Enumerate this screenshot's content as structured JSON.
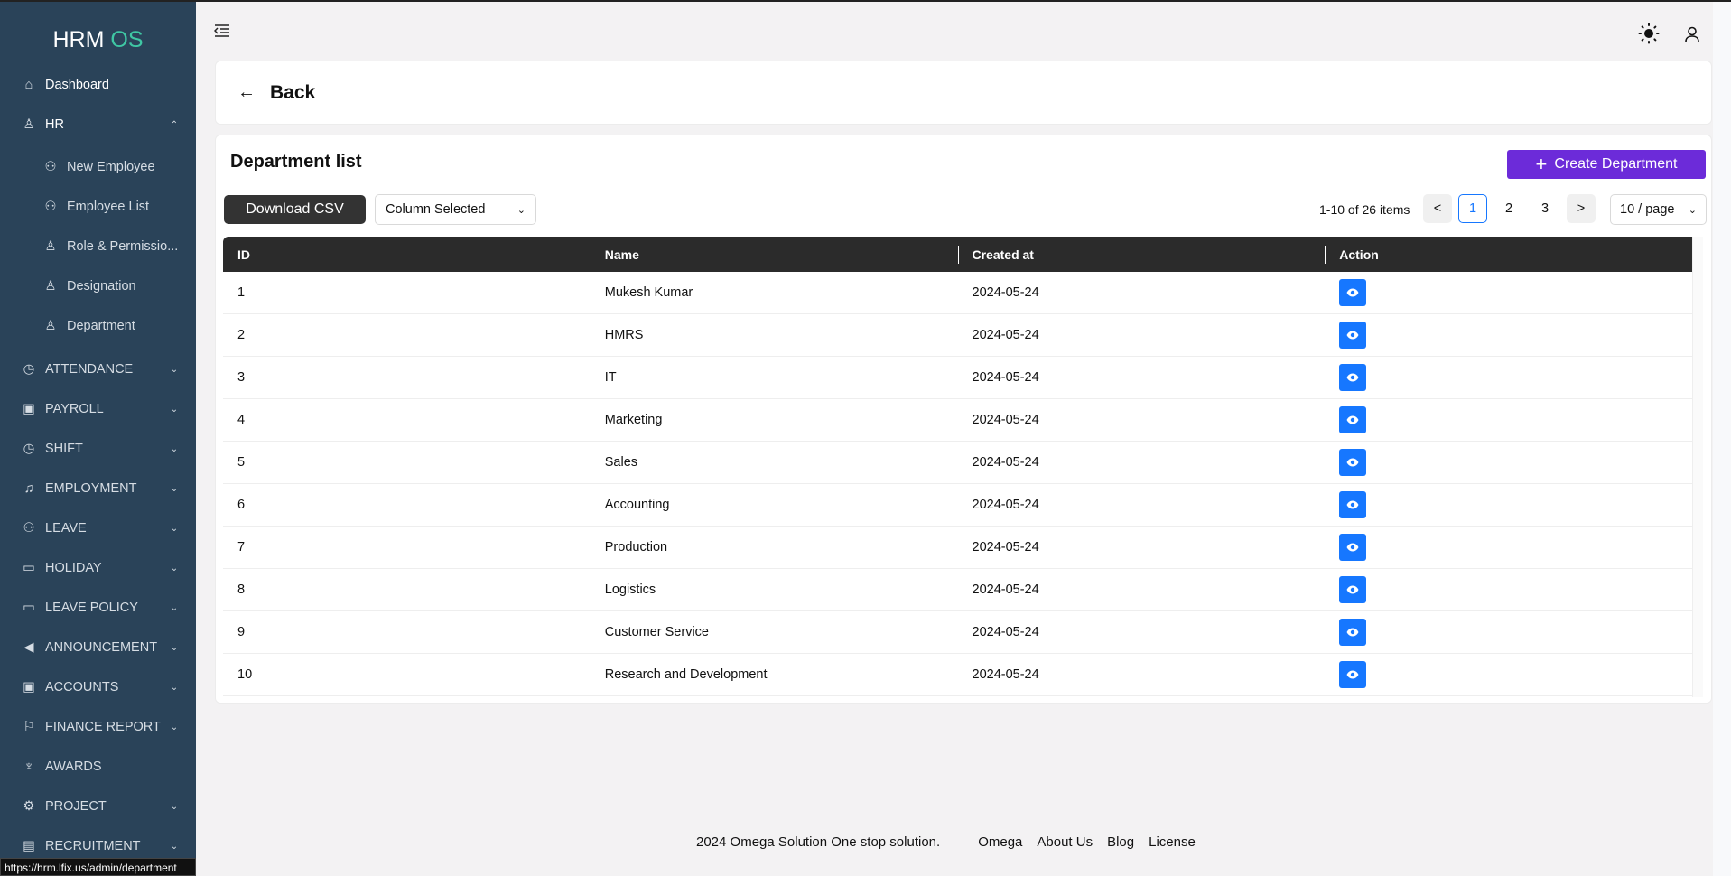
{
  "app": {
    "logo_main": "HRM",
    "logo_accent": "OS"
  },
  "sidebar": {
    "items": [
      {
        "label": "Dashboard",
        "icon": "home-icon"
      },
      {
        "label": "HR",
        "icon": "user-icon",
        "expanded": true
      },
      {
        "label": "New Employee",
        "icon": "users-icon"
      },
      {
        "label": "Employee List",
        "icon": "users-icon"
      },
      {
        "label": "Role & Permissio...",
        "icon": "user-gear-icon"
      },
      {
        "label": "Designation",
        "icon": "user-gear-icon"
      },
      {
        "label": "Department",
        "icon": "user-gear-icon"
      },
      {
        "label": "ATTENDANCE",
        "icon": "clock-icon"
      },
      {
        "label": "PAYROLL",
        "icon": "wallet-icon"
      },
      {
        "label": "SHIFT",
        "icon": "clock-icon"
      },
      {
        "label": "EMPLOYMENT",
        "icon": "bell-icon"
      },
      {
        "label": "LEAVE",
        "icon": "users-icon"
      },
      {
        "label": "HOLIDAY",
        "icon": "calendar-icon"
      },
      {
        "label": "LEAVE POLICY",
        "icon": "calendar-icon"
      },
      {
        "label": "ANNOUNCEMENT",
        "icon": "megaphone-icon"
      },
      {
        "label": "ACCOUNTS",
        "icon": "wallet-icon"
      },
      {
        "label": "FINANCE REPORT",
        "icon": "flag-icon"
      },
      {
        "label": "AWARDS",
        "icon": "trophy-icon"
      },
      {
        "label": "PROJECT",
        "icon": "gear-icon"
      },
      {
        "label": "RECRUITMENT",
        "icon": "document-search-icon"
      }
    ]
  },
  "status_url": "https://hrm.lfix.us/admin/department",
  "back": {
    "label": "Back"
  },
  "main": {
    "title": "Department list",
    "create_label": "Create Department",
    "download_label": "Download CSV",
    "column_select": "Column Selected",
    "pagination": {
      "info": "1-10 of 26 items",
      "pages": [
        "1",
        "2",
        "3"
      ],
      "current": "1",
      "page_size": "10 / page",
      "prev": "<",
      "next": ">"
    },
    "columns": [
      "ID",
      "Name",
      "Created at",
      "Action"
    ],
    "rows": [
      {
        "id": "1",
        "name": "Mukesh Kumar",
        "created": "2024-05-24"
      },
      {
        "id": "2",
        "name": "HMRS",
        "created": "2024-05-24"
      },
      {
        "id": "3",
        "name": "IT",
        "created": "2024-05-24"
      },
      {
        "id": "4",
        "name": "Marketing",
        "created": "2024-05-24"
      },
      {
        "id": "5",
        "name": "Sales",
        "created": "2024-05-24"
      },
      {
        "id": "6",
        "name": "Accounting",
        "created": "2024-05-24"
      },
      {
        "id": "7",
        "name": "Production",
        "created": "2024-05-24"
      },
      {
        "id": "8",
        "name": "Logistics",
        "created": "2024-05-24"
      },
      {
        "id": "9",
        "name": "Customer Service",
        "created": "2024-05-24"
      },
      {
        "id": "10",
        "name": "Research and Development",
        "created": "2024-05-24"
      }
    ]
  },
  "footer": {
    "copyright": "2024 Omega Solution One stop solution.",
    "links": [
      "Omega",
      "About Us",
      "Blog",
      "License"
    ]
  },
  "colors": {
    "sidebar": "#2a4359",
    "accent": "#3fc7a4",
    "primary": "#6c2bd9",
    "action": "#1677ff"
  }
}
